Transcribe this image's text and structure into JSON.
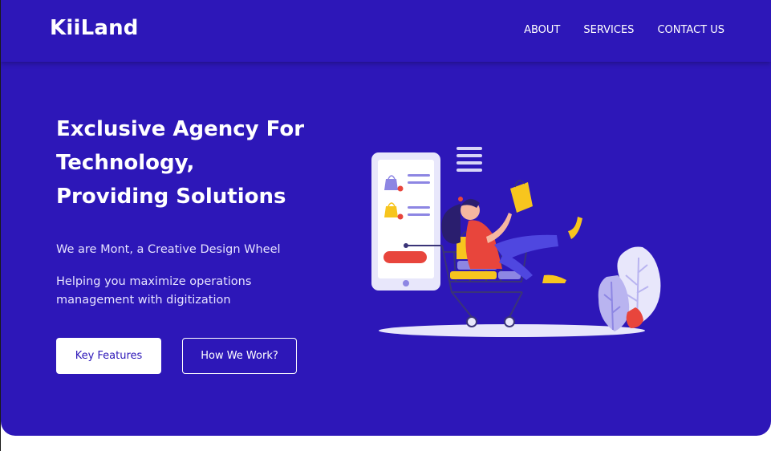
{
  "brand": {
    "name": "KiiLand"
  },
  "nav": {
    "links": [
      {
        "label": "ABOUT"
      },
      {
        "label": "SERVICES"
      },
      {
        "label": "CONTACT US"
      }
    ]
  },
  "hero": {
    "headline": [
      "Exclusive Agency For",
      "Technology,",
      "Providing Solutions"
    ],
    "tagline": "We are Mont, a Creative Design Wheel",
    "subtext": "Helping you maximize operations management with digitization",
    "primary_button": "Key Features",
    "secondary_button": "How We Work?"
  },
  "colors": {
    "brand_background": "#2d17b8",
    "button_background": "#ffffff",
    "accent_yellow": "#f7c51e",
    "accent_red": "#e8453c",
    "illustration_light": "#e8e7fb"
  },
  "illustration": {
    "name": "shopping-cart-illustration"
  }
}
